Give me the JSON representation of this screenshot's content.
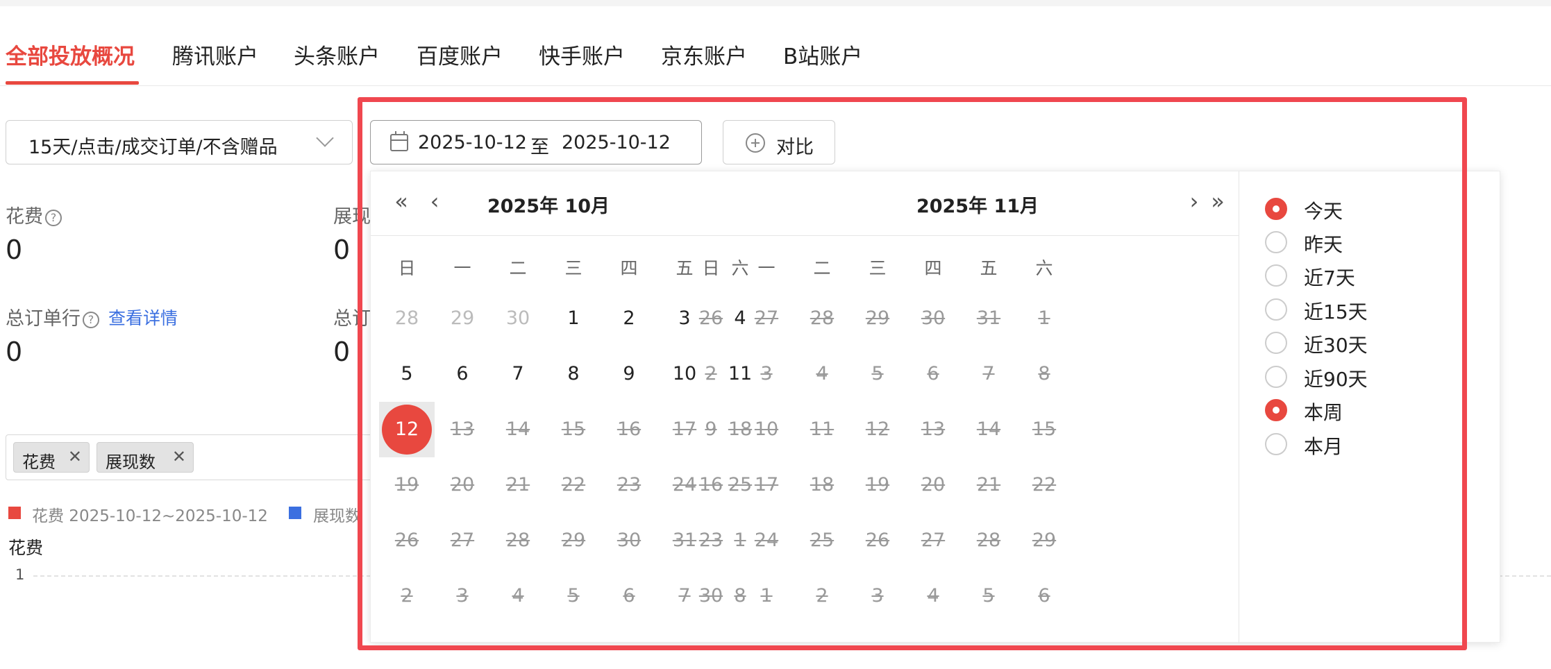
{
  "tabs": [
    "全部投放概况",
    "腾讯账户",
    "头条账户",
    "百度账户",
    "快手账户",
    "京东账户",
    "B站账户"
  ],
  "filter": {
    "attribution": "15天/点击/成交订单/不含赠品",
    "date_start": "2025-10-12",
    "date_sep": "至",
    "date_end": "2025-10-12",
    "compare": "对比"
  },
  "metrics": {
    "cost_label": "花费",
    "cost_value": "0",
    "impr_label": "展现",
    "impr_value": "0",
    "orders_label": "总订单行",
    "orders_value": "0",
    "orders_link": "查看详情",
    "total_label": "总订",
    "total_value": "0"
  },
  "tags": [
    "花费",
    "展现数"
  ],
  "legend": [
    {
      "label": "花费 2025-10-12~2025-10-12",
      "color": "#e8483f"
    },
    {
      "label": "展现数",
      "color": "#3b6fe0"
    }
  ],
  "chart": {
    "y_title": "花费",
    "y_tick": "1"
  },
  "picker": {
    "weekdays": [
      "日",
      "一",
      "二",
      "三",
      "四",
      "五",
      "六"
    ],
    "left_title": "2025年 10月",
    "right_title": "2025年 11月",
    "left_days": [
      "28",
      "29",
      "30",
      "1",
      "2",
      "3",
      "4",
      "5",
      "6",
      "7",
      "8",
      "9",
      "10",
      "11",
      "12",
      "13",
      "14",
      "15",
      "16",
      "17",
      "18",
      "19",
      "20",
      "21",
      "22",
      "23",
      "24",
      "25",
      "26",
      "27",
      "28",
      "29",
      "30",
      "31",
      "1",
      "2",
      "3",
      "4",
      "5",
      "6",
      "7",
      "8"
    ],
    "right_days": [
      "26",
      "27",
      "28",
      "29",
      "30",
      "31",
      "1",
      "2",
      "3",
      "4",
      "5",
      "6",
      "7",
      "8",
      "9",
      "10",
      "11",
      "12",
      "13",
      "14",
      "15",
      "16",
      "17",
      "18",
      "19",
      "20",
      "21",
      "22",
      "23",
      "24",
      "25",
      "26",
      "27",
      "28",
      "29",
      "30",
      "1",
      "2",
      "3",
      "4",
      "5",
      "6"
    ],
    "quick": [
      {
        "label": "今天",
        "checked": true
      },
      {
        "label": "昨天",
        "checked": false
      },
      {
        "label": "近7天",
        "checked": false
      },
      {
        "label": "近15天",
        "checked": false
      },
      {
        "label": "近30天",
        "checked": false
      },
      {
        "label": "近90天",
        "checked": false
      },
      {
        "label": "本周",
        "checked": true
      },
      {
        "label": "本月",
        "checked": false
      }
    ],
    "accent": "#e8483f"
  }
}
